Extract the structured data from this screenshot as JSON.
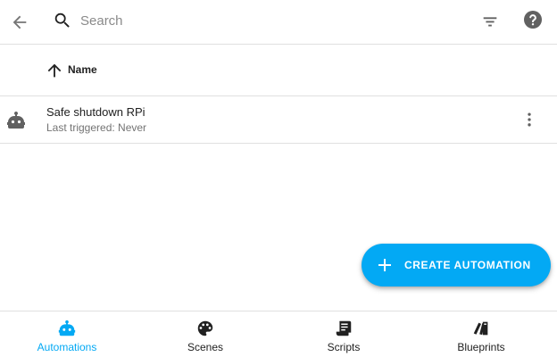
{
  "colors": {
    "accent": "#03a9f4",
    "icon_gray": "#616161",
    "text_secondary": "#737373"
  },
  "topbar": {
    "back_icon": "arrow-left-icon",
    "search_icon": "magnify-icon",
    "search_placeholder": "Search",
    "filter_icon": "filter-variant-icon",
    "help_icon": "help-circle-icon"
  },
  "table": {
    "sort_icon": "arrow-up-icon",
    "column_name": "Name",
    "rows": [
      {
        "icon": "robot-icon",
        "title": "Safe shutdown RPi",
        "subtitle": "Last triggered: Never",
        "menu_icon": "dots-vertical-icon"
      }
    ]
  },
  "fab": {
    "icon": "plus-icon",
    "label": "CREATE AUTOMATION"
  },
  "bottom_nav": {
    "active": "Automations",
    "items": [
      {
        "label": "Automations",
        "icon": "robot-icon"
      },
      {
        "label": "Scenes",
        "icon": "palette-icon"
      },
      {
        "label": "Scripts",
        "icon": "script-text-icon"
      },
      {
        "label": "Blueprints",
        "icon": "blueprint-icon"
      }
    ]
  }
}
